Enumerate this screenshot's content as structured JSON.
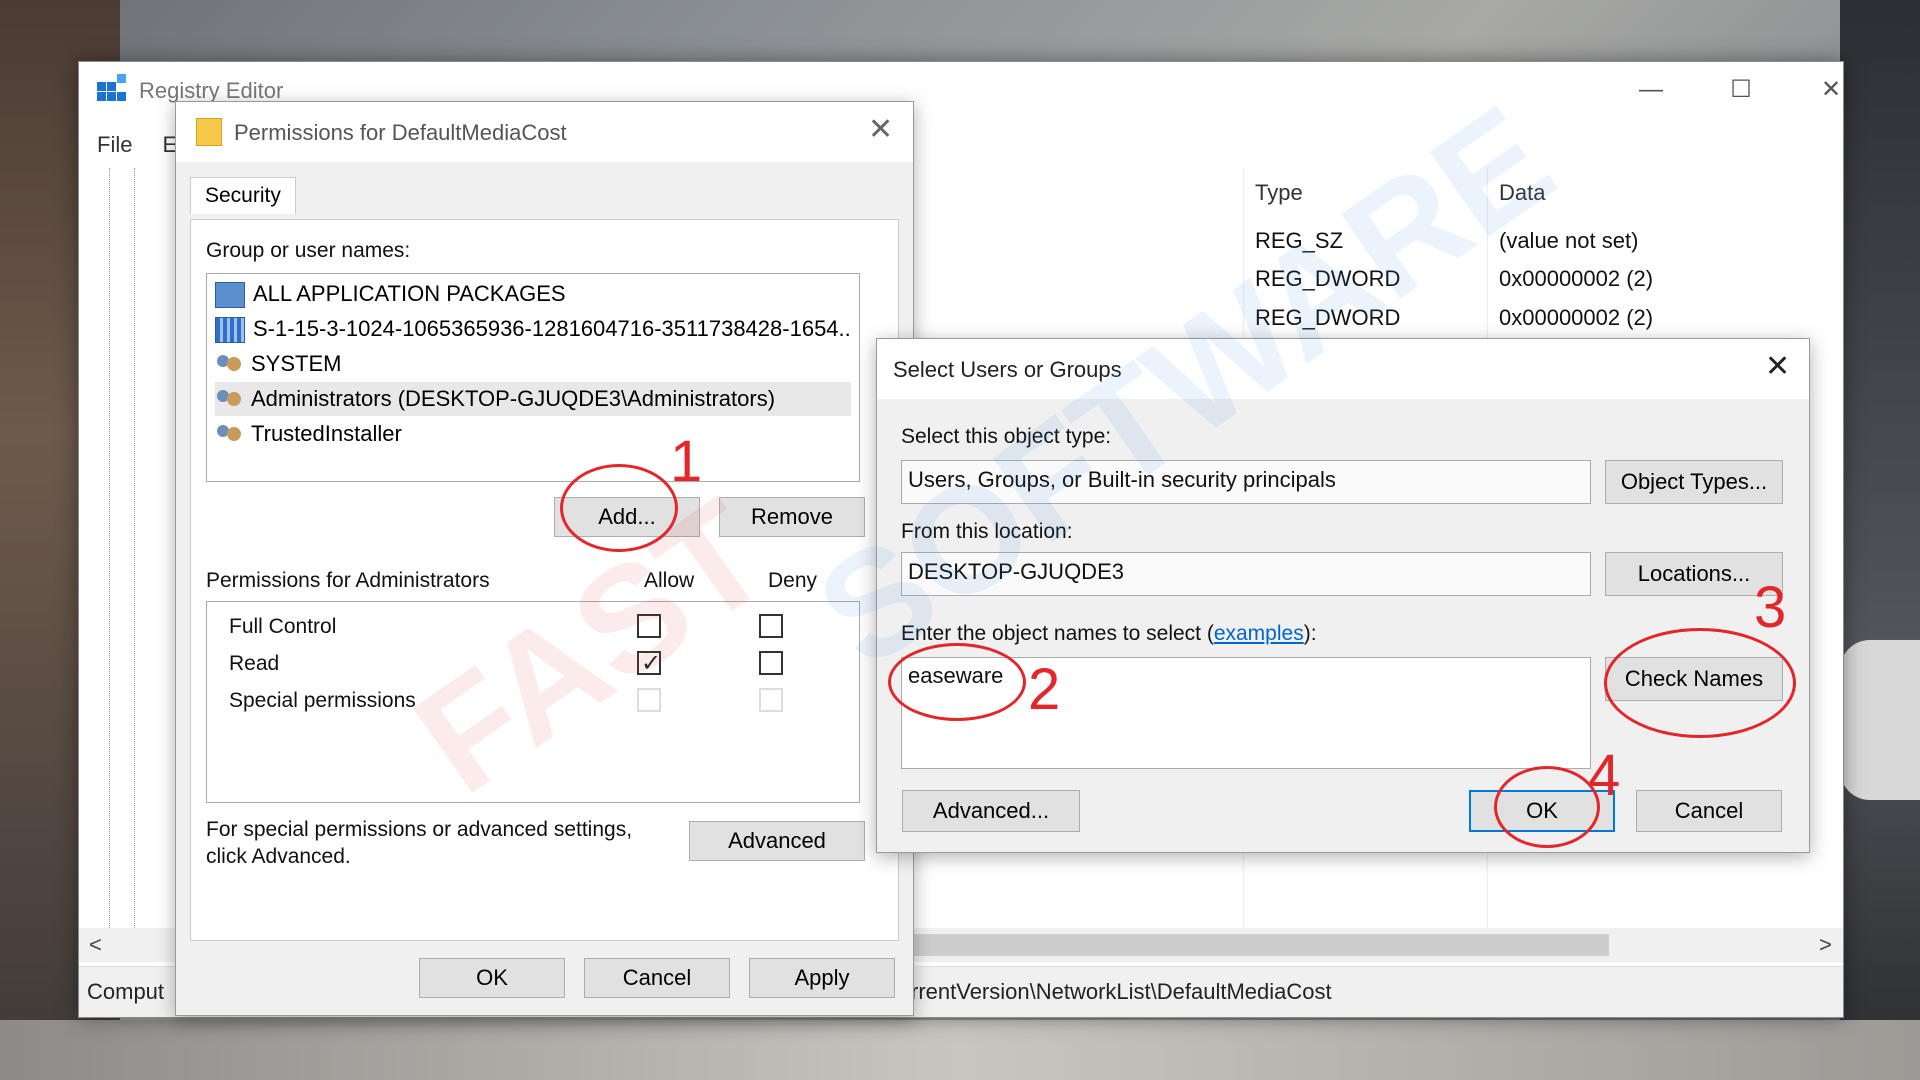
{
  "registry": {
    "title": "Registry Editor",
    "menu": [
      "File",
      "E"
    ],
    "columns": {
      "type": "Type",
      "data": "Data"
    },
    "rows": [
      {
        "type": "REG_SZ",
        "data": "(value not set)"
      },
      {
        "type": "REG_DWORD",
        "data": "0x00000002 (2)"
      },
      {
        "type": "REG_DWORD",
        "data": "0x00000002 (2)"
      }
    ],
    "status_left": "Comput",
    "status_path": "rrentVersion\\NetworkList\\DefaultMediaCost",
    "controls": {
      "minimize": "—",
      "maximize": "☐",
      "close": "✕"
    },
    "scroll": {
      "left": "<",
      "right": ">"
    }
  },
  "permissions": {
    "title": "Permissions for DefaultMediaCost",
    "close": "✕",
    "tab": "Security",
    "group_label": "Group or user names:",
    "users": [
      {
        "icon": "package-icon",
        "name": "ALL APPLICATION PACKAGES"
      },
      {
        "icon": "sid-icon",
        "name": "S-1-15-3-1024-1065365936-1281604716-3511738428-1654..."
      },
      {
        "icon": "users-icon",
        "name": "SYSTEM"
      },
      {
        "icon": "users-icon",
        "name": "Administrators (DESKTOP-GJUQDE3\\Administrators)",
        "selected": true
      },
      {
        "icon": "users-icon",
        "name": "TrustedInstaller"
      }
    ],
    "add_label": "Add...",
    "remove_label": "Remove",
    "perm_label": "Permissions for Administrators",
    "allow_label": "Allow",
    "deny_label": "Deny",
    "perm_rows": [
      {
        "name": "Full Control",
        "allow": false,
        "deny": false,
        "disabled": false
      },
      {
        "name": "Read",
        "allow": true,
        "deny": false,
        "disabled": false
      },
      {
        "name": "Special permissions",
        "allow": false,
        "deny": false,
        "disabled": true
      }
    ],
    "advanced_note_1": "For special permissions or advanced settings,",
    "advanced_note_2": "click Advanced.",
    "advanced_label": "Advanced",
    "ok_label": "OK",
    "cancel_label": "Cancel",
    "apply_label": "Apply"
  },
  "select_users": {
    "title": "Select Users or Groups",
    "close": "✕",
    "object_type_label": "Select this object type:",
    "object_type_value": "Users, Groups, or Built-in security principals",
    "object_types_button": "Object Types...",
    "location_label": "From this location:",
    "location_value": "DESKTOP-GJUQDE3",
    "locations_button": "Locations...",
    "names_label_prefix": "Enter the object names to select (",
    "names_label_link": "examples",
    "names_label_suffix": "):",
    "names_value": "easeware",
    "check_names_button": "Check Names",
    "advanced_button": "Advanced...",
    "ok_label": "OK",
    "cancel_label": "Cancel"
  },
  "annotations": [
    "1",
    "2",
    "3",
    "4"
  ],
  "watermark": {
    "part1": "FAST",
    "part2": "SOFTWARE"
  },
  "colors": {
    "annotation": "#e3262a",
    "accent": "#0078d7",
    "link": "#0066cc"
  }
}
